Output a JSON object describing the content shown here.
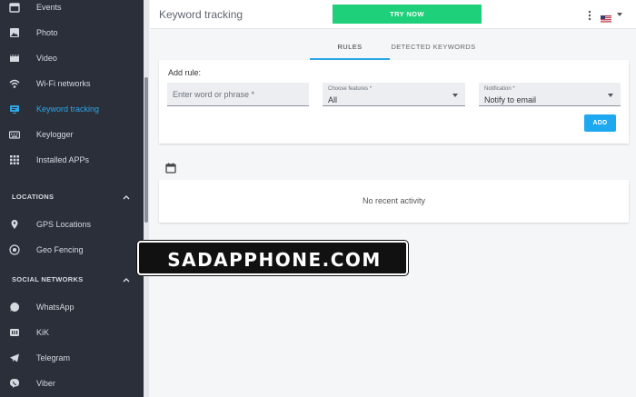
{
  "sidebar": {
    "items": [
      {
        "label": "Events",
        "icon": "calendar-icon"
      },
      {
        "label": "Photo",
        "icon": "photo-icon"
      },
      {
        "label": "Video",
        "icon": "video-icon"
      },
      {
        "label": "Wi-Fi networks",
        "icon": "wifi-icon"
      },
      {
        "label": "Keyword tracking",
        "icon": "keyword-tracking-icon",
        "active": true
      },
      {
        "label": "Keylogger",
        "icon": "keyboard-icon"
      },
      {
        "label": "Installed APPs",
        "icon": "apps-grid-icon"
      }
    ],
    "locations_section": {
      "label": "LOCATIONS"
    },
    "location_items": [
      {
        "label": "GPS Locations",
        "icon": "location-pin-icon"
      },
      {
        "label": "Geo Fencing",
        "icon": "geofence-icon"
      }
    ],
    "social_section": {
      "label": "SOCIAL NETWORKS"
    },
    "social_items": [
      {
        "label": "WhatsApp",
        "icon": "whatsapp-icon"
      },
      {
        "label": "KiK",
        "icon": "kik-icon"
      },
      {
        "label": "Telegram",
        "icon": "telegram-icon"
      },
      {
        "label": "Viber",
        "icon": "viber-icon"
      }
    ]
  },
  "header": {
    "title": "Keyword tracking",
    "try_button": "TRY NOW"
  },
  "tabs": [
    {
      "label": "RULES",
      "active": true
    },
    {
      "label": "DETECTED KEYWORDS",
      "active": false
    }
  ],
  "rule_form": {
    "title": "Add rule:",
    "word_placeholder": "Enter word or phrase *",
    "features_label": "Choose features *",
    "features_value": "All",
    "notification_label": "Notification *",
    "notification_value": "Notify to email",
    "add_button": "ADD"
  },
  "activity": {
    "empty_text": "No recent activity"
  },
  "watermark": "SADAPPHONE.COM",
  "colors": {
    "sidebar_bg": "#2a2f3a",
    "accent": "#2fa6e8",
    "try_button": "#1ed07a"
  }
}
